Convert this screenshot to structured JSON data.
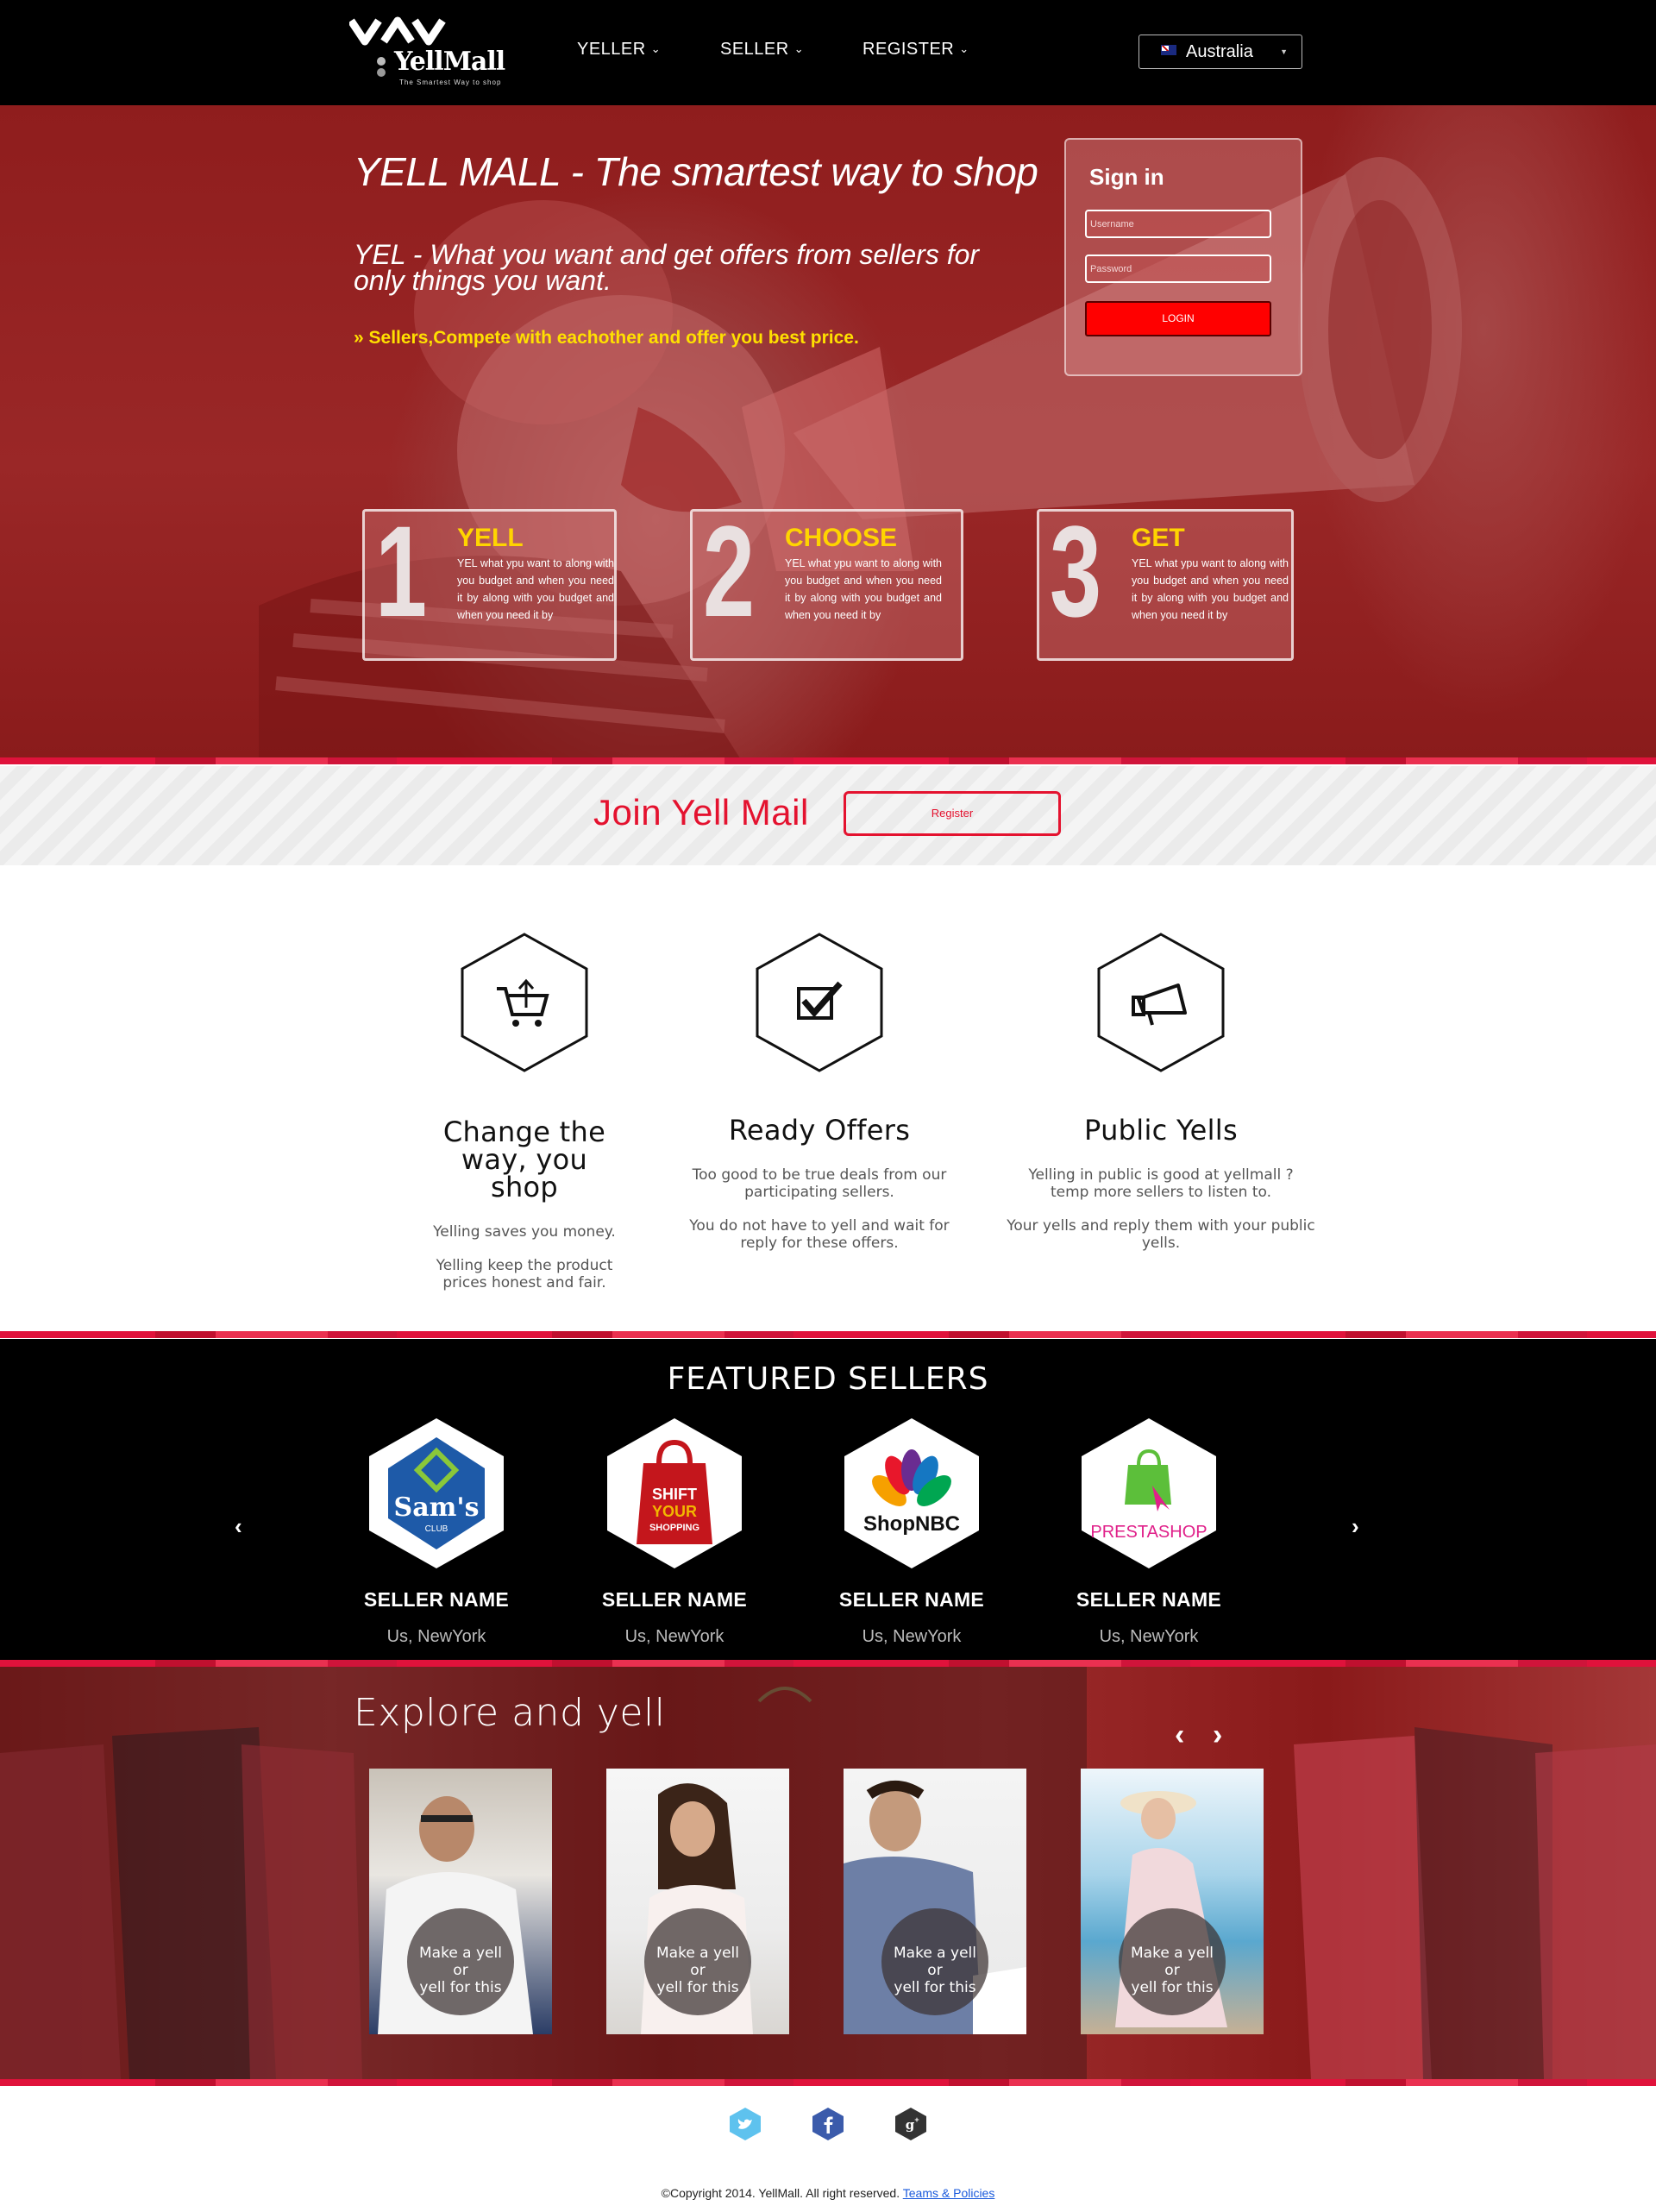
{
  "brand": {
    "name": "YellMall",
    "tagline": "The Smartest Way to shop"
  },
  "nav": {
    "items": [
      "YELLER",
      "SELLER",
      "REGISTER"
    ]
  },
  "country": {
    "selected": "Australia"
  },
  "hero": {
    "title": "YELL MALL - The smartest way to shop",
    "subtitle": "YEL - What you want and get offers from sellers for only things you want.",
    "bullet": "» Sellers,Compete with eachother and offer you best price."
  },
  "signin": {
    "title": "Sign in",
    "username_placeholder": "Username",
    "password_placeholder": "Password",
    "login_label": "LOGIN"
  },
  "steps": [
    {
      "number": "1",
      "title": "YELL",
      "text": "YEL what ypu want to along with you budget and when you need it by along with you budget and when you need it by"
    },
    {
      "number": "2",
      "title": "CHOOSE",
      "text": "YEL what ypu want to along with you budget and when you need it by along with you budget and when you need it by"
    },
    {
      "number": "3",
      "title": "GET",
      "text": "YEL what ypu want to along with you budget and when you need it by along with you budget and when you need it by"
    }
  ],
  "join": {
    "title": "Join Yell Mail",
    "button": "Register"
  },
  "features": [
    {
      "icon": "cart-icon",
      "title": "Change the way, you shop",
      "lines": [
        "Yelling saves you money.",
        "Yelling keep the product prices honest and fair."
      ]
    },
    {
      "icon": "checkbox-icon",
      "title": "Ready Offers",
      "lines": [
        "Too good to be true deals from our participating sellers.",
        "You do not have to yell and wait for reply for these offers."
      ]
    },
    {
      "icon": "megaphone-icon",
      "title": "Public Yells",
      "lines": [
        "Yelling in public is good at yellmall ? temp more sellers to listen to.",
        "Your yells and reply them with your public yells."
      ]
    }
  ],
  "featured": {
    "title": "FEATURED SELLERS",
    "sellers": [
      {
        "logo": "Sam's",
        "logo_sub": "CLUB",
        "name": "SELLER NAME",
        "location": "Us, NewYork"
      },
      {
        "logo": "SHIFT YOUR SHOPPING",
        "name": "SELLER NAME",
        "location": "Us, NewYork"
      },
      {
        "logo": "ShopNBC",
        "name": "SELLER NAME",
        "location": "Us, NewYork"
      },
      {
        "logo": "PRESTASHOP",
        "name": "SELLER NAME",
        "location": "Us, NewYork"
      }
    ]
  },
  "explore": {
    "title": "Explore and yell",
    "cards": [
      {
        "line1": "Make a yell",
        "line2": "or",
        "line3": "yell for this"
      },
      {
        "line1": "Make a yell",
        "line2": "or",
        "line3": "yell for this"
      },
      {
        "line1": "Make a yell",
        "line2": "or",
        "line3": "yell for this"
      },
      {
        "line1": "Make a yell",
        "line2": "or",
        "line3": "yell for this"
      }
    ]
  },
  "footer": {
    "social": [
      "twitter-icon",
      "facebook-icon",
      "google-plus-icon"
    ],
    "copyright": "©Copyright 2014. YellMall. All right reserved.",
    "policy_link": "Teams & Policies"
  },
  "colors": {
    "accent": "#e4122f",
    "hero": "#9a2727",
    "yellow": "#ffd400"
  }
}
